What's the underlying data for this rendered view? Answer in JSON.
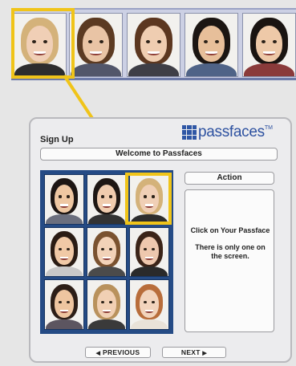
{
  "top_strip": {
    "faces": [
      {
        "name": "strip-face-1",
        "hair": "#d4b27a",
        "skin": "#f0cfb6",
        "body": "#2d2d2d"
      },
      {
        "name": "strip-face-2",
        "hair": "#5b3a22",
        "skin": "#e9c4a5",
        "body": "#52566a"
      },
      {
        "name": "strip-face-3",
        "hair": "#5c3720",
        "skin": "#efcdb1",
        "body": "#3e3e46"
      },
      {
        "name": "strip-face-4",
        "hair": "#1b1512",
        "skin": "#e7bf9a",
        "body": "#4f6387"
      },
      {
        "name": "strip-face-5",
        "hair": "#1a1411",
        "skin": "#eec9a8",
        "body": "#8a3a3a"
      }
    ]
  },
  "dialog": {
    "title": "Sign Up",
    "logo_text": "passfaces",
    "logo_tm": "TM",
    "welcome": "Welcome to Passfaces",
    "action_label": "Action",
    "instructions": [
      "Click on Your Passface",
      "There is only one on the screen."
    ],
    "prev_label": "PREVIOUS",
    "next_label": "NEXT",
    "prev_arrow": "◀",
    "next_arrow": "▶"
  },
  "grid_faces": [
    {
      "name": "grid-face-1",
      "hair": "#1c1512",
      "skin": "#eec7a2",
      "body": "#6b6f7e"
    },
    {
      "name": "grid-face-2",
      "hair": "#1e1713",
      "skin": "#f0ccae",
      "body": "#333"
    },
    {
      "name": "grid-face-3",
      "hair": "#d4b27a",
      "skin": "#f0cfb6",
      "body": "#2d2d2d"
    },
    {
      "name": "grid-face-4",
      "hair": "#2a1c14",
      "skin": "#f0c9a6",
      "body": "#c8c8c8"
    },
    {
      "name": "grid-face-5",
      "hair": "#7a5230",
      "skin": "#f2d2b8",
      "body": "#4b4b4b"
    },
    {
      "name": "grid-face-6",
      "hair": "#3b2418",
      "skin": "#eec8ae",
      "body": "#2a2a2a"
    },
    {
      "name": "grid-face-7",
      "hair": "#2c1e17",
      "skin": "#eec5a0",
      "body": "#5c5560"
    },
    {
      "name": "grid-face-8",
      "hair": "#b9925d",
      "skin": "#f1d0b4",
      "body": "#3a3a3a"
    },
    {
      "name": "grid-face-9",
      "hair": "#b86d3b",
      "skin": "#f2d4bd",
      "body": "#e9e2d8"
    }
  ],
  "colors": {
    "highlight": "#f0c419",
    "grid_background": "#254b85",
    "logo": "#2d51a0"
  }
}
